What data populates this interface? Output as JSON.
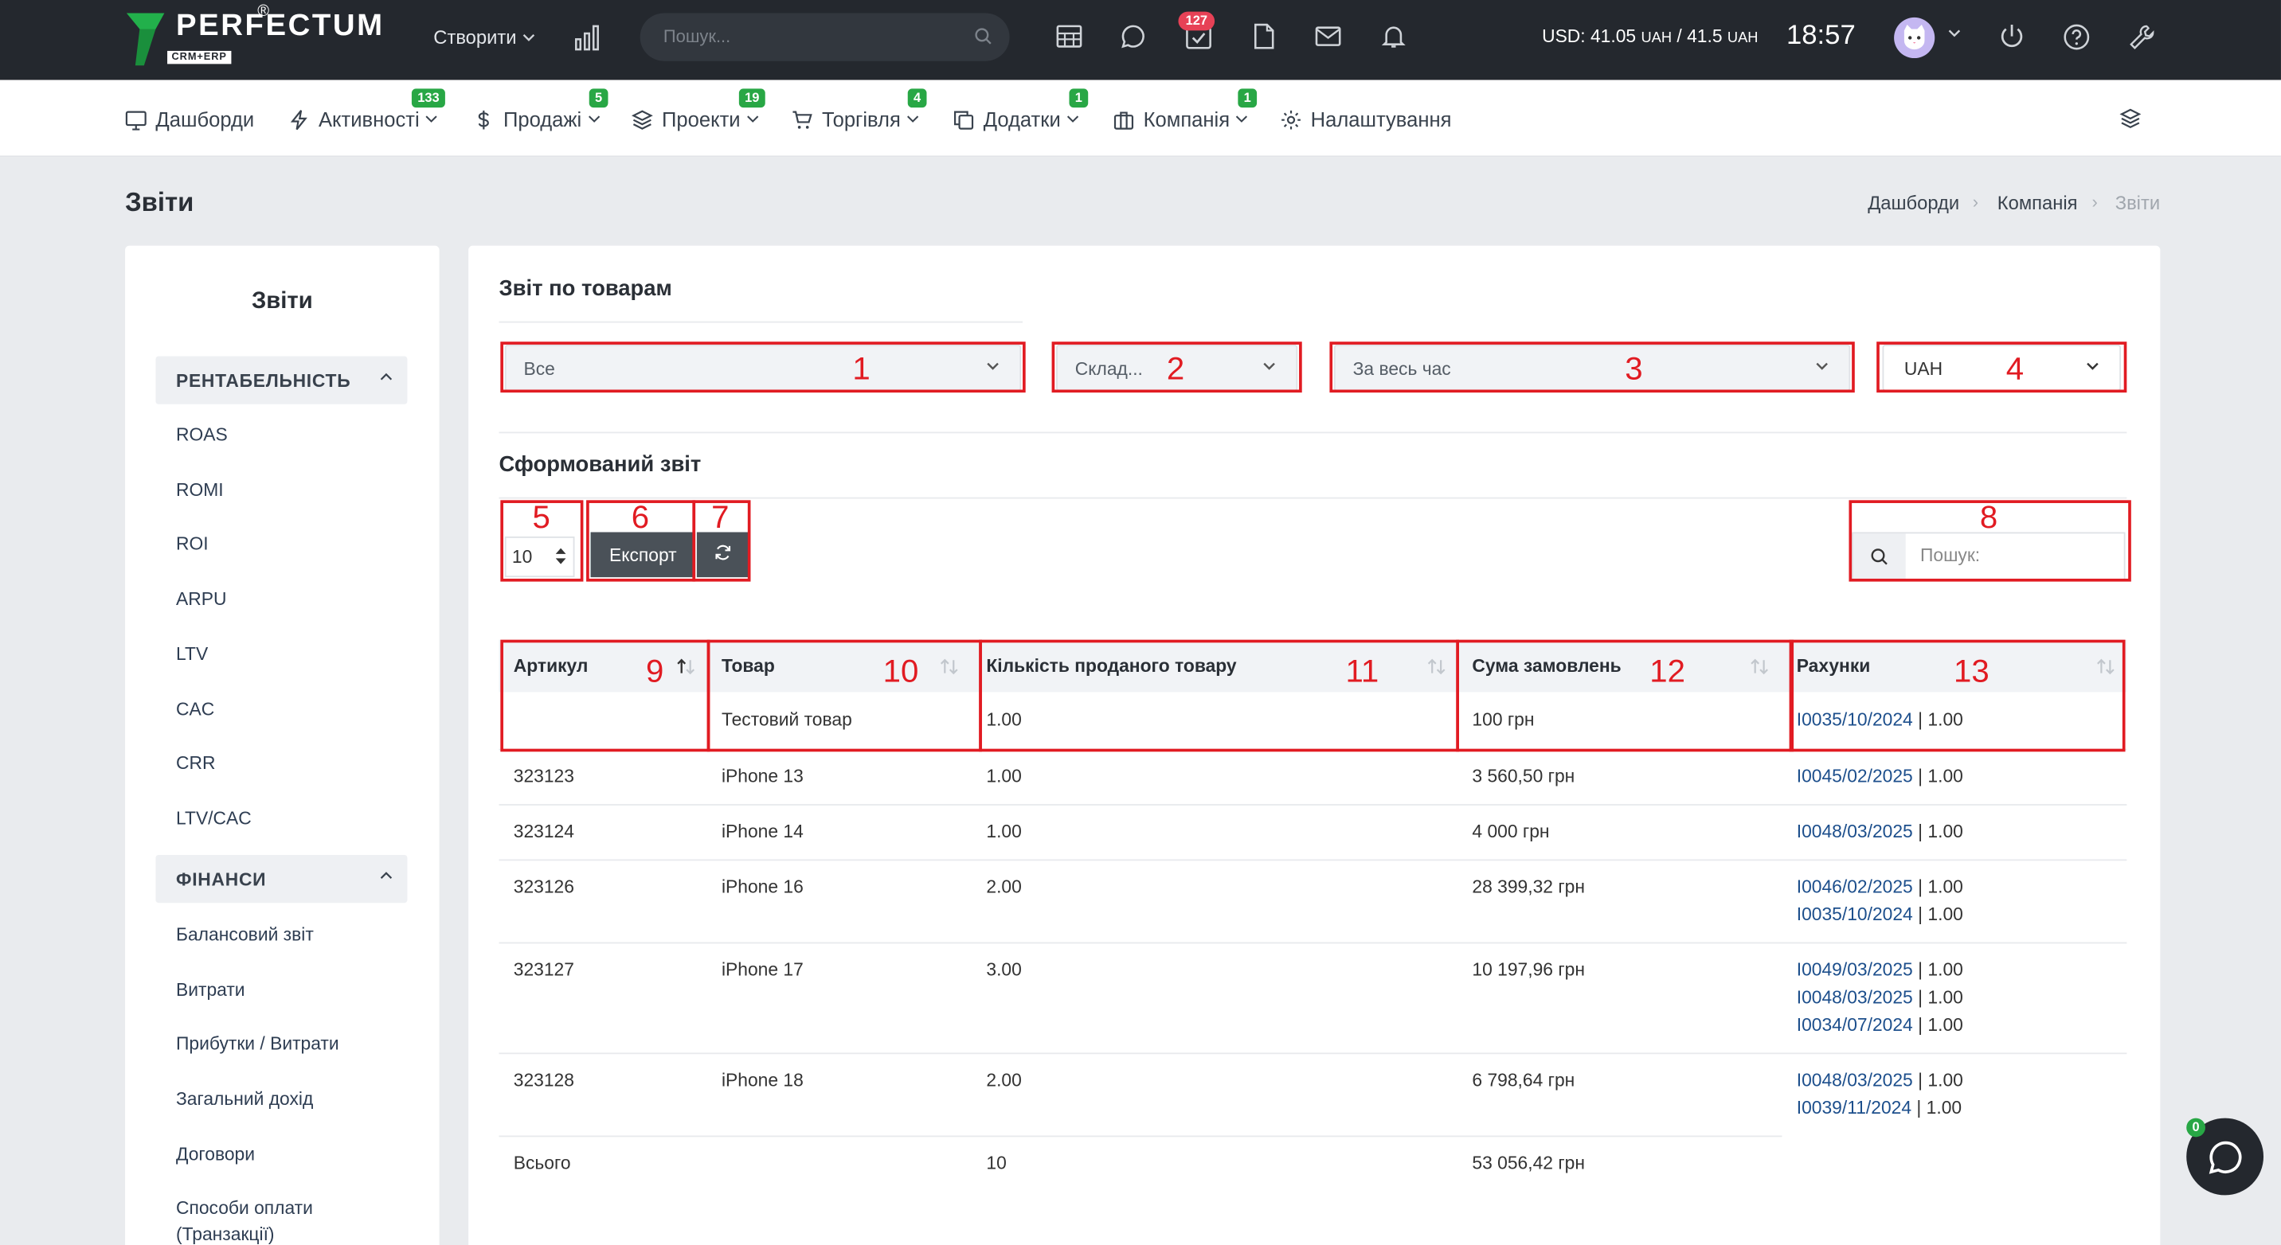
{
  "topbar": {
    "logo_text": "PERFECTUM",
    "logo_sub": "CRM+ERP",
    "logo_reg": "®",
    "create_label": "Створити",
    "search_placeholder": "Пошук...",
    "tasks_badge": "127",
    "rate_usd": "USD: 41.05",
    "rate_uah1": "UAH",
    "rate_sep": " / 41.5",
    "rate_uah2": "UAH",
    "clock": "18:57"
  },
  "nav": {
    "items": [
      {
        "label": "Дашборди",
        "icon": "monitor-icon"
      },
      {
        "label": "Активності",
        "icon": "lightning-icon",
        "badge": "133"
      },
      {
        "label": "Продажі",
        "icon": "dollar-icon",
        "badge": "5"
      },
      {
        "label": "Проекти",
        "icon": "layers-icon",
        "badge": "19"
      },
      {
        "label": "Торгівля",
        "icon": "cart-icon",
        "badge": "4"
      },
      {
        "label": "Додатки",
        "icon": "copy-icon",
        "badge": "1"
      },
      {
        "label": "Компанія",
        "icon": "briefcase-icon",
        "badge": "1"
      },
      {
        "label": "Налаштування",
        "icon": "gear-icon"
      }
    ]
  },
  "page": {
    "title": "Звіти",
    "breadcrumb": [
      "Дашборди",
      "Компанія",
      "Звіти"
    ]
  },
  "sidebar": {
    "title": "Звіти",
    "sections": [
      {
        "title": "РЕНТАБЕЛЬНІСТЬ",
        "links": [
          "ROAS",
          "ROMI",
          "ROI",
          "ARPU",
          "LTV",
          "CAC",
          "CRR",
          "LTV/CAC"
        ]
      },
      {
        "title": "ФІНАНСИ",
        "links": [
          "Балансовий звіт",
          "Витрати",
          "Прибутки / Витрати",
          "Загальний дохід",
          "Договори",
          "Способи оплати",
          "(Транзакції)"
        ]
      }
    ]
  },
  "report": {
    "title": "Звіт по товарам",
    "filters": {
      "category": "Все",
      "warehouse": "Склад...",
      "period": "За весь час",
      "currency": "UAH"
    },
    "generated_title": "Сформований звіт",
    "per_page": "10",
    "export_label": "Експорт",
    "search_placeholder": "Пошук:",
    "columns": [
      "Артикул",
      "Товар",
      "Кількість проданого товару",
      "Сума замовлень",
      "Рахунки"
    ],
    "rows": [
      {
        "sku": "",
        "product": "Тестовий товар",
        "qty": "1.00",
        "sum": "100 грн",
        "invoices": [
          {
            "id": "I0035/10/2024",
            "qty": "1.00"
          }
        ]
      },
      {
        "sku": "323123",
        "product": "iPhone 13",
        "qty": "1.00",
        "sum": "3 560,50 грн",
        "invoices": [
          {
            "id": "I0045/02/2025",
            "qty": "1.00"
          }
        ]
      },
      {
        "sku": "323124",
        "product": "iPhone 14",
        "qty": "1.00",
        "sum": "4 000 грн",
        "invoices": [
          {
            "id": "I0048/03/2025",
            "qty": "1.00"
          }
        ]
      },
      {
        "sku": "323126",
        "product": "iPhone 16",
        "qty": "2.00",
        "sum": "28 399,32 грн",
        "invoices": [
          {
            "id": "I0046/02/2025",
            "qty": "1.00"
          },
          {
            "id": "I0035/10/2024",
            "qty": "1.00"
          }
        ]
      },
      {
        "sku": "323127",
        "product": "iPhone 17",
        "qty": "3.00",
        "sum": "10 197,96 грн",
        "invoices": [
          {
            "id": "I0049/03/2025",
            "qty": "1.00"
          },
          {
            "id": "I0048/03/2025",
            "qty": "1.00"
          },
          {
            "id": "I0034/07/2024",
            "qty": "1.00"
          }
        ]
      },
      {
        "sku": "323128",
        "product": "iPhone 18",
        "qty": "2.00",
        "sum": "6 798,64 грн",
        "invoices": [
          {
            "id": "I0048/03/2025",
            "qty": "1.00"
          },
          {
            "id": "I0039/11/2024",
            "qty": "1.00"
          }
        ]
      }
    ],
    "total": {
      "label": "Всього",
      "qty": "10",
      "sum": "53 056,42 грн"
    }
  },
  "annotations": [
    "1",
    "2",
    "3",
    "4",
    "5",
    "6",
    "7",
    "8",
    "9",
    "10",
    "11",
    "12",
    "13"
  ],
  "chat_badge": "0",
  "colors": {
    "topbar": "#24282e",
    "annotation": "#e11b22",
    "badge_green": "#28a745",
    "badge_red": "#e74156",
    "link": "#1d4f8c"
  }
}
